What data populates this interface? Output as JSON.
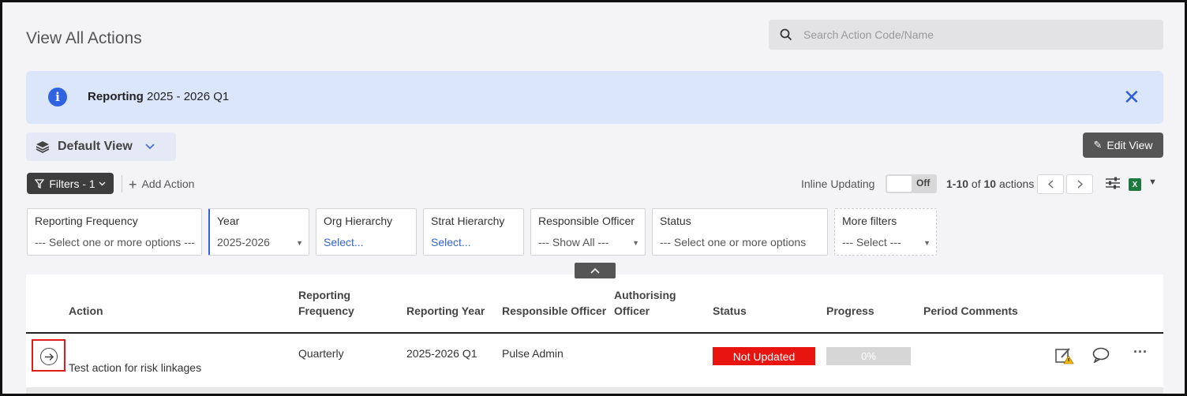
{
  "page": {
    "title": "View All Actions"
  },
  "search": {
    "placeholder": "Search Action Code/Name",
    "value": ""
  },
  "banner": {
    "label_bold": "Reporting",
    "label_value": "2025 - 2026 Q1",
    "close_glyph": "✕",
    "info_glyph": "i"
  },
  "view": {
    "name": "Default View",
    "edit_label": "Edit View"
  },
  "toolbar": {
    "filters_label": "Filters - 1",
    "add_action_label": "Add Action",
    "inline_updating_label": "Inline Updating",
    "toggle_state": "Off",
    "pager_range": "1-10",
    "pager_of": "of",
    "pager_total": "10",
    "pager_suffix": "actions"
  },
  "filters": [
    {
      "title": "Reporting Frequency",
      "value": "--- Select one or more options ---",
      "style": "plain"
    },
    {
      "title": "Year",
      "value": "2025-2026",
      "style": "dropdown"
    },
    {
      "title": "Org Hierarchy",
      "value": "Select...",
      "style": "link"
    },
    {
      "title": "Strat Hierarchy",
      "value": "Select...",
      "style": "link"
    },
    {
      "title": "Responsible Officer",
      "value": "--- Show All ---",
      "style": "dropdown"
    },
    {
      "title": "Status",
      "value": "--- Select one or more options",
      "style": "plain"
    },
    {
      "title": "More filters",
      "value": "--- Select ---",
      "style": "dropdown"
    }
  ],
  "table": {
    "headers": {
      "action": "Action",
      "reporting_frequency_1": "Reporting",
      "reporting_frequency_2": "Frequency",
      "reporting_year": "Reporting Year",
      "responsible_officer": "Responsible Officer",
      "authorising_officer_1": "Authorising",
      "authorising_officer_2": "Officer",
      "status": "Status",
      "progress": "Progress",
      "period_comments": "Period Comments"
    },
    "rows": [
      {
        "action": "Test action for risk linkages",
        "reporting_frequency": "Quarterly",
        "reporting_year": "2025-2026 Q1",
        "responsible_officer": "Pulse Admin",
        "authorising_officer": "",
        "status": "Not Updated",
        "progress": "0%",
        "period_comments": ""
      }
    ]
  },
  "colors": {
    "accent": "#2f63e0",
    "status_not_updated": "#e8140f",
    "banner_bg": "#dce6fb",
    "excel_green": "#1d7a3f"
  },
  "icons": [
    "search-icon",
    "info-icon",
    "close-icon",
    "layers-icon",
    "chevron-down-icon",
    "pencil-icon",
    "filter-icon",
    "plus-icon",
    "chevron-left-icon",
    "chevron-right-icon",
    "sliders-icon",
    "excel-icon",
    "chevron-up-icon",
    "arrow-right-circle-icon",
    "edit-warning-icon",
    "comment-icon",
    "more-icon"
  ]
}
